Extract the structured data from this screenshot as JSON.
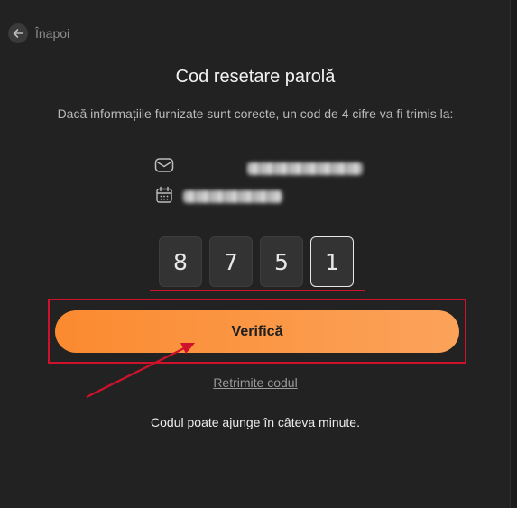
{
  "nav": {
    "back_label": "Înapoi",
    "back_icon": "arrow-left-icon"
  },
  "heading": {
    "title": "Cod resetare parolă"
  },
  "description": "Dacă informațiile furnizate sunt corecte, un cod de 4 cifre va fi trimis la:",
  "contact": {
    "email_icon": "envelope-icon",
    "date_icon": "calendar-icon"
  },
  "code": {
    "digits": [
      "8",
      "7",
      "5",
      "1"
    ],
    "active_index": 3
  },
  "actions": {
    "verify_label": "Verifică",
    "resend_label": "Retrimite codul"
  },
  "footer_note": "Codul poate ajunge în câteva minute.",
  "colors": {
    "accent_start": "#fb8a30",
    "accent_end": "#fba35a",
    "annotation_red": "#d0112b",
    "background": "#222222"
  }
}
